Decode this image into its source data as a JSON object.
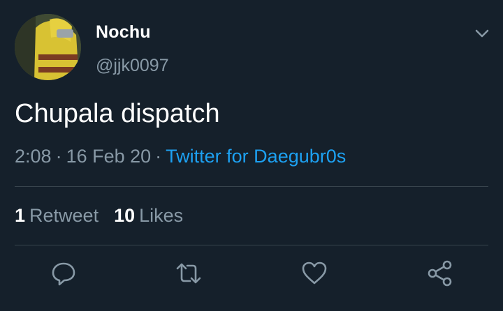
{
  "user": {
    "display_name": "Nochu",
    "handle": "@jjk0097"
  },
  "tweet": {
    "text": "Chupala dispatch",
    "time": "2:08",
    "date": "16 Feb 20",
    "source": "Twitter for Daegubr0s"
  },
  "stats": {
    "retweets_count": "1",
    "retweets_label": "Retweet",
    "likes_count": "10",
    "likes_label": "Likes"
  },
  "icons": {
    "menu": "chevron-down-icon",
    "reply": "reply-icon",
    "retweet": "retweet-icon",
    "like": "heart-icon",
    "share": "share-icon"
  },
  "colors": {
    "background": "#15202b",
    "secondary_text": "#8899a6",
    "link": "#1da1f2",
    "divider": "#38444d"
  }
}
